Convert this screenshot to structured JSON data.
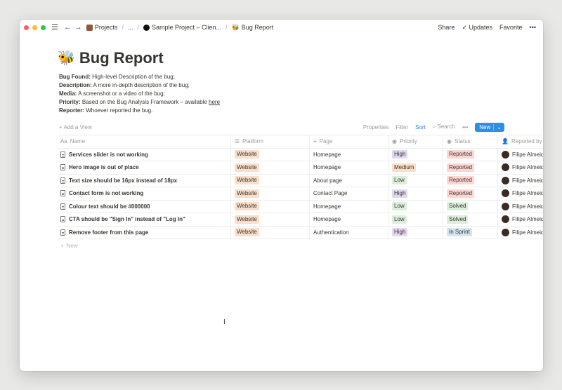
{
  "topbar": {
    "breadcrumbs": [
      {
        "label": "Projects"
      },
      {
        "label": "..."
      },
      {
        "label": "Sample Project – Clien..."
      },
      {
        "label": "Bug Report",
        "emoji": "🐝"
      }
    ],
    "share": "Share",
    "updates": "Updates",
    "favorite": "Favorite",
    "more": "•••"
  },
  "page": {
    "emoji": "🐝",
    "title": "Bug Report",
    "desc": [
      {
        "label": "Bug Found:",
        "text": " High-level Description of the bug;"
      },
      {
        "label": "Description:",
        "text": " A more in-depth description of the bug;"
      },
      {
        "label": "Media:",
        "text": " A screenshot or a video of the bug;"
      },
      {
        "label": "Priority:",
        "text": " Based on the Bug Analysis Framework – available ",
        "link": "here"
      },
      {
        "label": "Reporter:",
        "text": " Whoever reported the bug."
      }
    ]
  },
  "viewbar": {
    "add_view": "Add a View",
    "properties": "Properties",
    "filter": "Filter",
    "sort": "Sort",
    "search": "Search",
    "more": "•••",
    "new": "New"
  },
  "table": {
    "columns": [
      "Name",
      "Platform",
      "Page",
      "Priority",
      "Status",
      "Reported by"
    ],
    "rows": [
      {
        "name": "Services slider is not working",
        "platform": "Website",
        "page": "Homepage",
        "priority": "High",
        "status": "Reported",
        "reporter": "Filipe Almeida"
      },
      {
        "name": "Hero image is out of place",
        "platform": "Website",
        "page": "Homepage",
        "priority": "Medium",
        "status": "Reported",
        "reporter": "Filipe Almeida"
      },
      {
        "name": "Text size should be 16px instead of 18px",
        "platform": "Website",
        "page": "About page",
        "priority": "Low",
        "status": "Reported",
        "reporter": "Filipe Almeida"
      },
      {
        "name": "Contact form is not working",
        "platform": "Website",
        "page": "Contact Page",
        "priority": "High",
        "status": "Reported",
        "reporter": "Filipe Almeida"
      },
      {
        "name": "Colour text should be #000000",
        "platform": "Website",
        "page": "Homepage",
        "priority": "Low",
        "status": "Solved",
        "reporter": "Filipe Almeida"
      },
      {
        "name": "CTA should be \"Sign In\" instead of \"Log In\"",
        "platform": "Website",
        "page": "Homepage",
        "priority": "Low",
        "status": "Solved",
        "reporter": "Filipe Almeida"
      },
      {
        "name": "Remove footer from this page",
        "platform": "Website",
        "page": "Authentication",
        "priority": "High",
        "status": "In Sprint",
        "reporter": "Filipe Almeida"
      }
    ],
    "new_row": "New"
  },
  "tag_colors": {
    "Website": "#fadec9",
    "High": "#e1d7f0",
    "Medium": "#fadec9",
    "Low": "#dbeddb",
    "Reported": "#ffd5d2",
    "Solved": "#dbeddb",
    "In Sprint": "#d3e5ef"
  },
  "help": "?"
}
